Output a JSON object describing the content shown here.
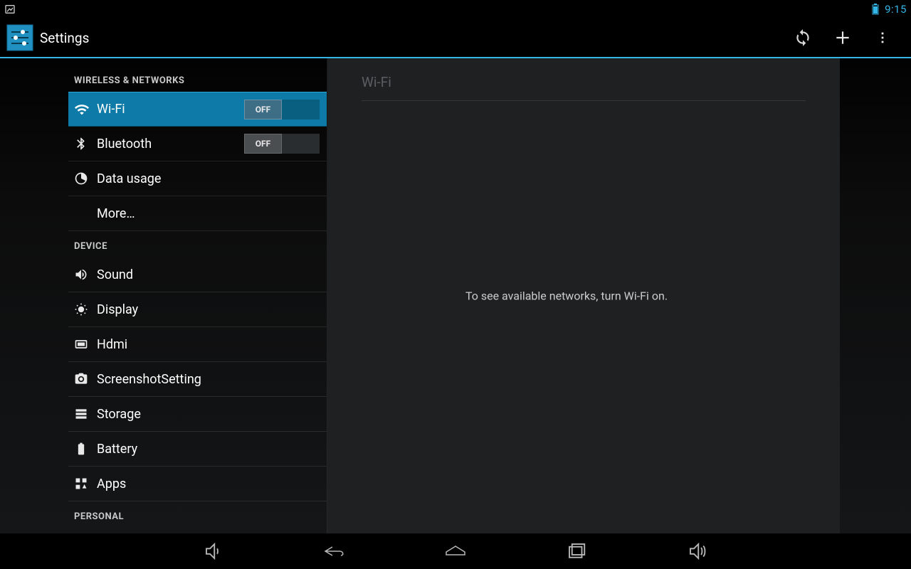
{
  "statusbar": {
    "time": "9:15"
  },
  "actionbar": {
    "title": "Settings"
  },
  "sidebar": {
    "sections": {
      "wireless": {
        "header": "WIRELESS & NETWORKS"
      },
      "device": {
        "header": "DEVICE"
      },
      "personal": {
        "header": "PERSONAL"
      }
    },
    "items": {
      "wifi": {
        "label": "Wi-Fi",
        "toggle": "OFF"
      },
      "bluetooth": {
        "label": "Bluetooth",
        "toggle": "OFF"
      },
      "data": {
        "label": "Data usage"
      },
      "more": {
        "label": "More…"
      },
      "sound": {
        "label": "Sound"
      },
      "display": {
        "label": "Display"
      },
      "hdmi": {
        "label": "Hdmi"
      },
      "screenshot": {
        "label": "ScreenshotSetting"
      },
      "storage": {
        "label": "Storage"
      },
      "battery": {
        "label": "Battery"
      },
      "apps": {
        "label": "Apps"
      }
    }
  },
  "detail": {
    "title": "Wi-Fi",
    "message": "To see available networks, turn Wi-Fi on."
  }
}
